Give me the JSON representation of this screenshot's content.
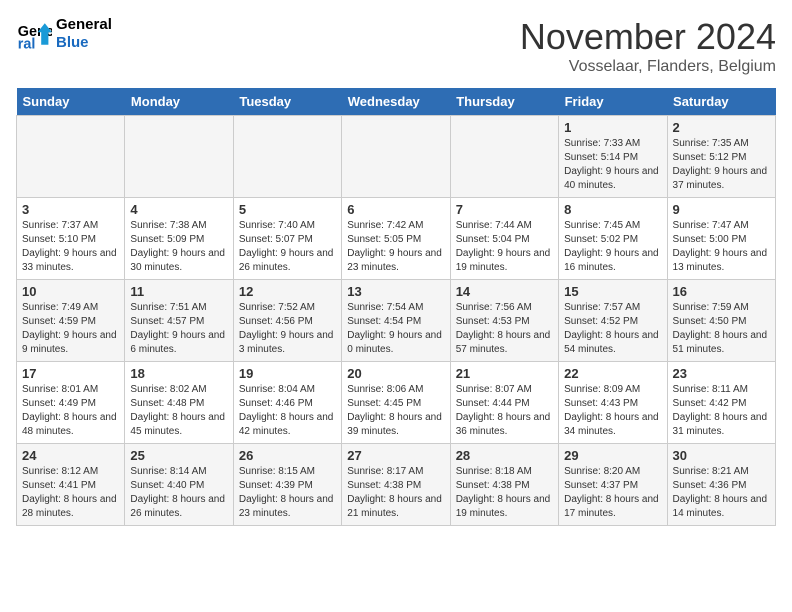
{
  "logo": {
    "line1": "General",
    "line2": "Blue"
  },
  "title": "November 2024",
  "location": "Vosselaar, Flanders, Belgium",
  "days_of_week": [
    "Sunday",
    "Monday",
    "Tuesday",
    "Wednesday",
    "Thursday",
    "Friday",
    "Saturday"
  ],
  "weeks": [
    [
      {
        "day": "",
        "info": ""
      },
      {
        "day": "",
        "info": ""
      },
      {
        "day": "",
        "info": ""
      },
      {
        "day": "",
        "info": ""
      },
      {
        "day": "",
        "info": ""
      },
      {
        "day": "1",
        "info": "Sunrise: 7:33 AM\nSunset: 5:14 PM\nDaylight: 9 hours and 40 minutes."
      },
      {
        "day": "2",
        "info": "Sunrise: 7:35 AM\nSunset: 5:12 PM\nDaylight: 9 hours and 37 minutes."
      }
    ],
    [
      {
        "day": "3",
        "info": "Sunrise: 7:37 AM\nSunset: 5:10 PM\nDaylight: 9 hours and 33 minutes."
      },
      {
        "day": "4",
        "info": "Sunrise: 7:38 AM\nSunset: 5:09 PM\nDaylight: 9 hours and 30 minutes."
      },
      {
        "day": "5",
        "info": "Sunrise: 7:40 AM\nSunset: 5:07 PM\nDaylight: 9 hours and 26 minutes."
      },
      {
        "day": "6",
        "info": "Sunrise: 7:42 AM\nSunset: 5:05 PM\nDaylight: 9 hours and 23 minutes."
      },
      {
        "day": "7",
        "info": "Sunrise: 7:44 AM\nSunset: 5:04 PM\nDaylight: 9 hours and 19 minutes."
      },
      {
        "day": "8",
        "info": "Sunrise: 7:45 AM\nSunset: 5:02 PM\nDaylight: 9 hours and 16 minutes."
      },
      {
        "day": "9",
        "info": "Sunrise: 7:47 AM\nSunset: 5:00 PM\nDaylight: 9 hours and 13 minutes."
      }
    ],
    [
      {
        "day": "10",
        "info": "Sunrise: 7:49 AM\nSunset: 4:59 PM\nDaylight: 9 hours and 9 minutes."
      },
      {
        "day": "11",
        "info": "Sunrise: 7:51 AM\nSunset: 4:57 PM\nDaylight: 9 hours and 6 minutes."
      },
      {
        "day": "12",
        "info": "Sunrise: 7:52 AM\nSunset: 4:56 PM\nDaylight: 9 hours and 3 minutes."
      },
      {
        "day": "13",
        "info": "Sunrise: 7:54 AM\nSunset: 4:54 PM\nDaylight: 9 hours and 0 minutes."
      },
      {
        "day": "14",
        "info": "Sunrise: 7:56 AM\nSunset: 4:53 PM\nDaylight: 8 hours and 57 minutes."
      },
      {
        "day": "15",
        "info": "Sunrise: 7:57 AM\nSunset: 4:52 PM\nDaylight: 8 hours and 54 minutes."
      },
      {
        "day": "16",
        "info": "Sunrise: 7:59 AM\nSunset: 4:50 PM\nDaylight: 8 hours and 51 minutes."
      }
    ],
    [
      {
        "day": "17",
        "info": "Sunrise: 8:01 AM\nSunset: 4:49 PM\nDaylight: 8 hours and 48 minutes."
      },
      {
        "day": "18",
        "info": "Sunrise: 8:02 AM\nSunset: 4:48 PM\nDaylight: 8 hours and 45 minutes."
      },
      {
        "day": "19",
        "info": "Sunrise: 8:04 AM\nSunset: 4:46 PM\nDaylight: 8 hours and 42 minutes."
      },
      {
        "day": "20",
        "info": "Sunrise: 8:06 AM\nSunset: 4:45 PM\nDaylight: 8 hours and 39 minutes."
      },
      {
        "day": "21",
        "info": "Sunrise: 8:07 AM\nSunset: 4:44 PM\nDaylight: 8 hours and 36 minutes."
      },
      {
        "day": "22",
        "info": "Sunrise: 8:09 AM\nSunset: 4:43 PM\nDaylight: 8 hours and 34 minutes."
      },
      {
        "day": "23",
        "info": "Sunrise: 8:11 AM\nSunset: 4:42 PM\nDaylight: 8 hours and 31 minutes."
      }
    ],
    [
      {
        "day": "24",
        "info": "Sunrise: 8:12 AM\nSunset: 4:41 PM\nDaylight: 8 hours and 28 minutes."
      },
      {
        "day": "25",
        "info": "Sunrise: 8:14 AM\nSunset: 4:40 PM\nDaylight: 8 hours and 26 minutes."
      },
      {
        "day": "26",
        "info": "Sunrise: 8:15 AM\nSunset: 4:39 PM\nDaylight: 8 hours and 23 minutes."
      },
      {
        "day": "27",
        "info": "Sunrise: 8:17 AM\nSunset: 4:38 PM\nDaylight: 8 hours and 21 minutes."
      },
      {
        "day": "28",
        "info": "Sunrise: 8:18 AM\nSunset: 4:38 PM\nDaylight: 8 hours and 19 minutes."
      },
      {
        "day": "29",
        "info": "Sunrise: 8:20 AM\nSunset: 4:37 PM\nDaylight: 8 hours and 17 minutes."
      },
      {
        "day": "30",
        "info": "Sunrise: 8:21 AM\nSunset: 4:36 PM\nDaylight: 8 hours and 14 minutes."
      }
    ]
  ]
}
